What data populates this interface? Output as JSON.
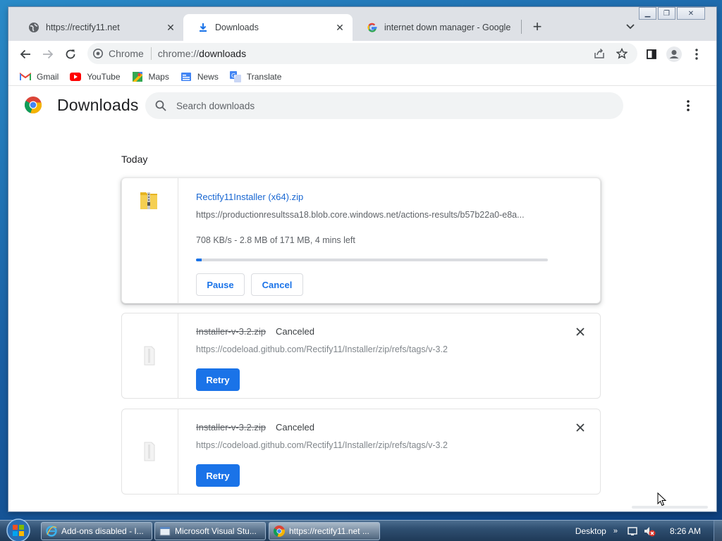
{
  "browser": {
    "tabs": [
      {
        "title": "https://rectify11.net",
        "icon": "globe-icon"
      },
      {
        "title": "Downloads",
        "icon": "download-icon"
      },
      {
        "title": "internet down manager - Google",
        "icon": "google-icon"
      }
    ],
    "omnibox": {
      "site_label": "Chrome",
      "url_scheme": "chrome://",
      "url_host": "downloads"
    },
    "bookmarks": [
      {
        "label": "Gmail",
        "icon": "gmail-icon"
      },
      {
        "label": "YouTube",
        "icon": "youtube-icon"
      },
      {
        "label": "Maps",
        "icon": "maps-icon"
      },
      {
        "label": "News",
        "icon": "news-icon"
      },
      {
        "label": "Translate",
        "icon": "translate-icon"
      }
    ]
  },
  "downloads_page": {
    "title": "Downloads",
    "search_placeholder": "Search downloads",
    "date_header": "Today",
    "items": [
      {
        "filename": "Rectify11Installer (x64).zip",
        "url": "https://productionresultssa18.blob.core.windows.net/actions-results/b57b22a0-e8a...",
        "progress_text": "708 KB/s - 2.8 MB of 171 MB, 4 mins left",
        "progress_fraction": 0.016,
        "buttons": {
          "pause": "Pause",
          "cancel": "Cancel"
        }
      },
      {
        "filename": "Installer-v-3.2.zip",
        "status": "Canceled",
        "url": "https://codeload.github.com/Rectify11/Installer/zip/refs/tags/v-3.2",
        "retry": "Retry"
      },
      {
        "filename": "Installer-v-3.2.zip",
        "status": "Canceled",
        "url": "https://codeload.github.com/Rectify11/Installer/zip/refs/tags/v-3.2",
        "retry": "Retry"
      }
    ]
  },
  "taskbar": {
    "tasks": [
      {
        "label": "Add-ons disabled - I...",
        "icon": "ie-icon"
      },
      {
        "label": "Microsoft Visual Stu...",
        "icon": "window-icon"
      },
      {
        "label": "https://rectify11.net ...",
        "icon": "chrome-icon"
      }
    ],
    "desktop_label": "Desktop",
    "time": "8:26 AM"
  },
  "colors": {
    "accent": "#1a73e8",
    "link": "#1967d2",
    "tabstrip": "#dee1e6"
  }
}
